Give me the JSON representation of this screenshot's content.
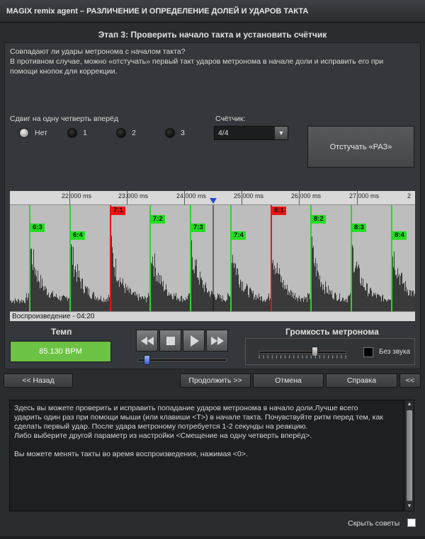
{
  "window": {
    "title": "MAGIX remix agent – РАЗЛИЧЕНИЕ И ОПРЕДЕЛЕНИЕ ДОЛЕЙ И УДАРОВ ТАКТА"
  },
  "step": {
    "title": "Этап 3: Проверить начало такта и установить счётчик"
  },
  "intro": {
    "line1": "Совпадают ли удары метронома с началом такта?",
    "line2": "В противном случае, можно «отстучать» первый такт ударов метронома в начале доли и исправить его при",
    "line3": "помощи кнопок для коррекции."
  },
  "shift": {
    "label": "Сдвиг на одну четверть вперёд",
    "options": [
      {
        "label": "Нет",
        "selected": true
      },
      {
        "label": "1",
        "selected": false
      },
      {
        "label": "2",
        "selected": false
      },
      {
        "label": "3",
        "selected": false
      }
    ]
  },
  "counter": {
    "label": "Счётчик:",
    "value": "4/4"
  },
  "tap_button": {
    "label": "Отстучать «РАЗ»"
  },
  "timeline": {
    "ticks": [
      "22.000 ms",
      "23.000 ms",
      "24.000 ms",
      "25.000 ms",
      "26.000 ms",
      "27.000 ms",
      "2"
    ],
    "beats": [
      "6:3",
      "6:4",
      "7:1",
      "7:2",
      "7:3",
      "7:4",
      "8:1",
      "8:2",
      "8:3",
      "8:4"
    ],
    "status": "Воспроизведение - 04:20"
  },
  "tempo": {
    "label": "Темп",
    "value": "85.130 BPM"
  },
  "transport": {
    "position_fraction": 0.08
  },
  "volume": {
    "label": "Громкость метронома",
    "level_fraction": 0.65,
    "mute_label": "Без звука"
  },
  "nav": {
    "back": "<< Назад",
    "continue": "Продолжить >>",
    "cancel": "Отмена",
    "help": "Справка",
    "collapse": "<<"
  },
  "help_text": {
    "p1": "Здесь вы можете проверить и исправить попадание ударов метронома в начало доли.Лучше всего",
    "p2": "ударить один раз при помощи мыши (или клавиши <T>) в начале такта. Почувствуйте ритм перед тем, как",
    "p3": "сделать первый удар. После удара метроному потребуется 1-2 секунды на реакцию.",
    "p4": "Либо выберите другой параметр из настройки <Смещение на одну четверть вперёд>.",
    "p5": "Вы можете менять такты во время воспроизведения, нажимая <0>."
  },
  "hide_tips": {
    "label": "Скрыть советы"
  },
  "colors": {
    "beat": "#22dd22",
    "downbeat": "#ee1111",
    "tempo": "#6cc244"
  }
}
